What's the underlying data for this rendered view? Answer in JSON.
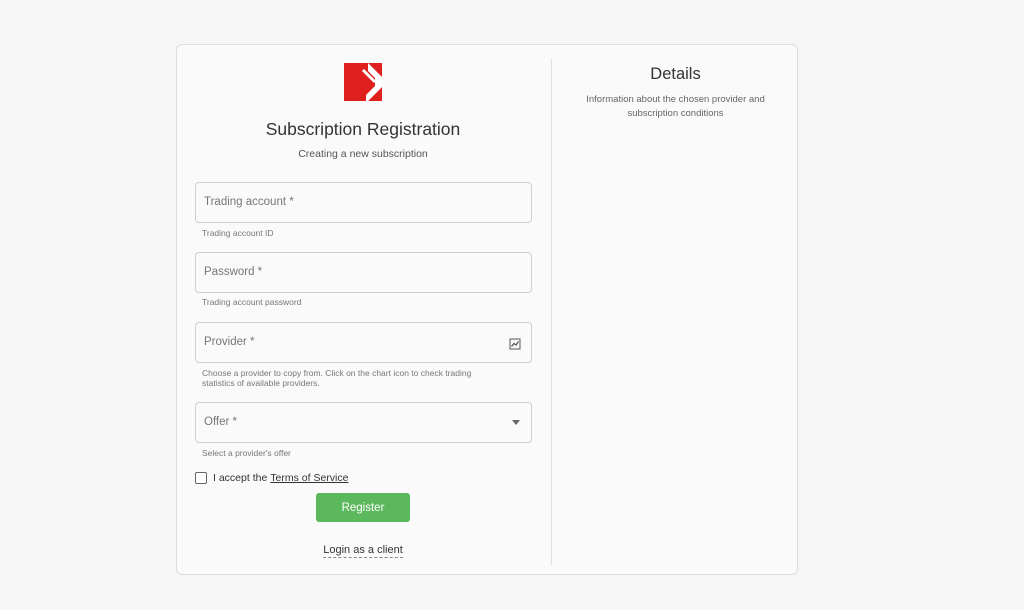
{
  "header": {
    "title": "Subscription Registration",
    "subtitle": "Creating a new subscription"
  },
  "form": {
    "trading_account": {
      "placeholder": "Trading account *",
      "helper": "Trading account ID"
    },
    "password": {
      "placeholder": "Password *",
      "helper": "Trading account password"
    },
    "provider": {
      "placeholder": "Provider *",
      "helper": "Choose a provider to copy from. Click on the chart icon to check trading statistics of available providers.",
      "icon": "chart-icon"
    },
    "offer": {
      "placeholder": "Offer *",
      "helper": "Select a provider's offer"
    },
    "terms": {
      "prefix": "I accept the",
      "link": "Terms of Service"
    },
    "register_label": "Register",
    "login_link": "Login as a client"
  },
  "details": {
    "title": "Details",
    "text": "Information about the chosen provider and subscription conditions"
  },
  "colors": {
    "brand": "#e0201f",
    "primary_button": "#5cb85c"
  }
}
